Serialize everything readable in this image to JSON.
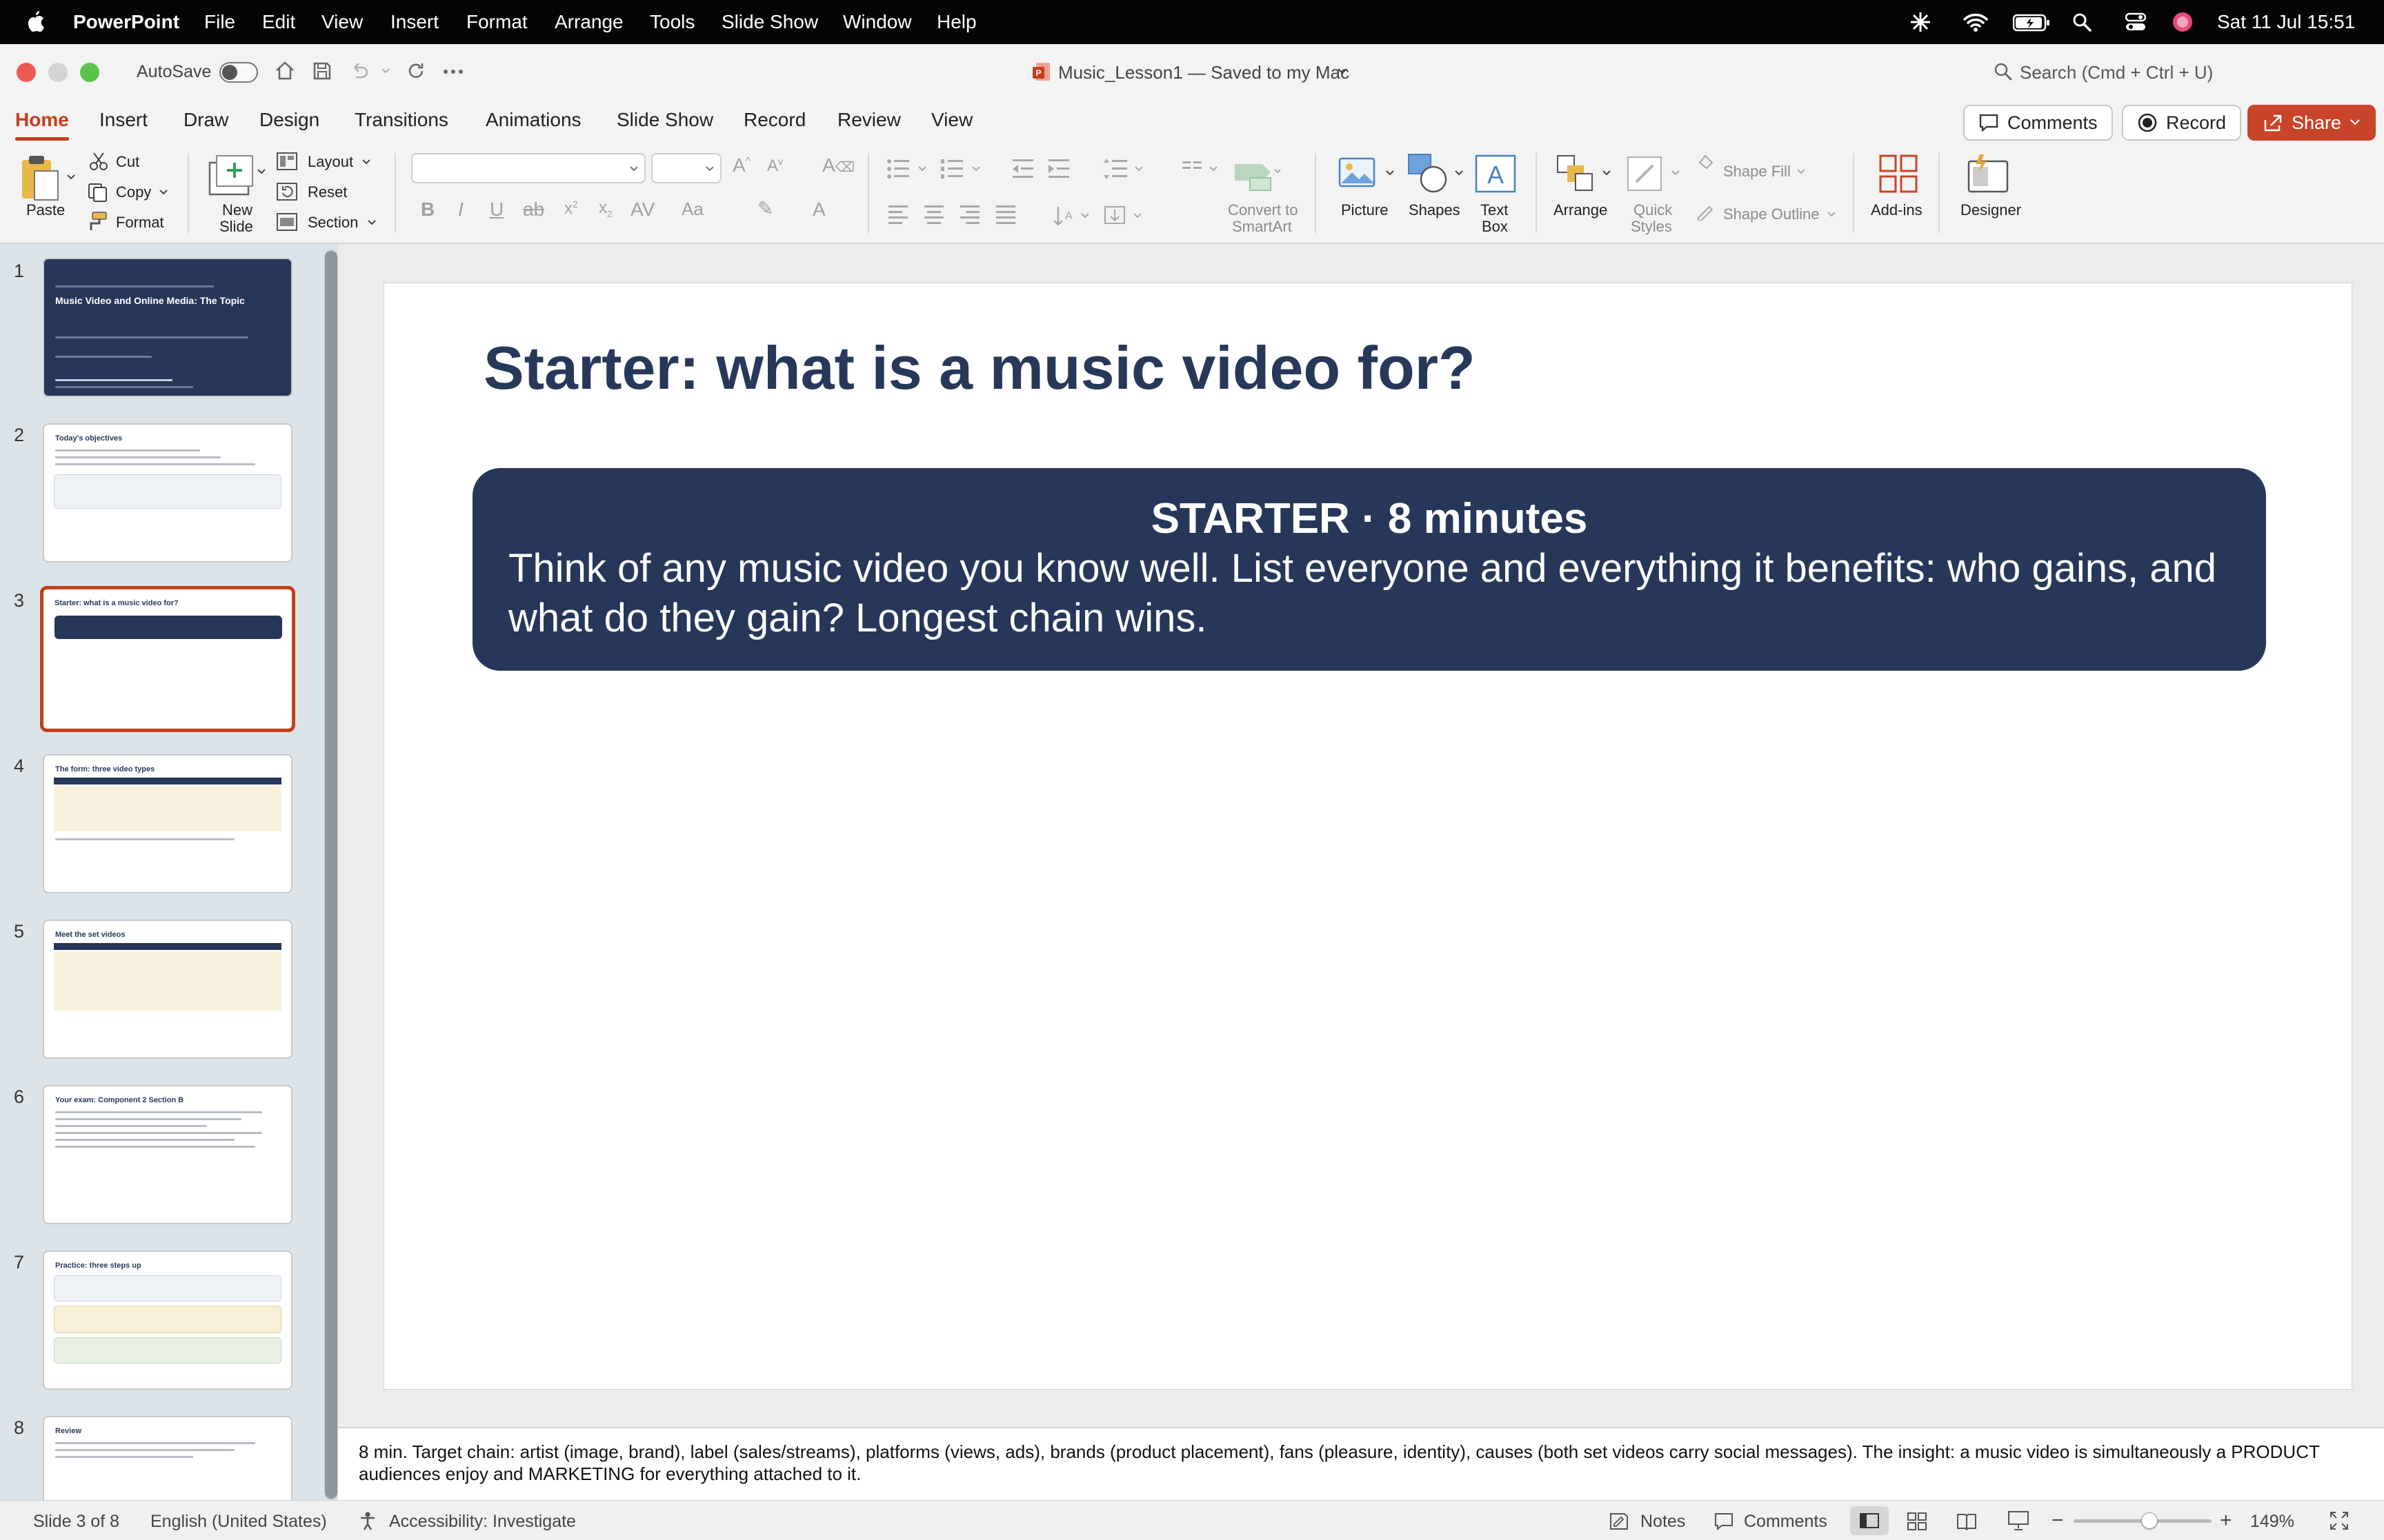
{
  "menubar": {
    "app_name": "PowerPoint",
    "items": [
      "File",
      "Edit",
      "View",
      "Insert",
      "Format",
      "Arrange",
      "Tools",
      "Slide Show",
      "Window",
      "Help"
    ],
    "datetime": "Sat 11 Jul  15:51"
  },
  "titlebar": {
    "autosave_label": "AutoSave",
    "doc_title": "Music_Lesson1 — Saved to my Mac",
    "search_placeholder": "Search (Cmd + Ctrl + U)"
  },
  "ribbon_tabs": {
    "tabs": [
      "Home",
      "Insert",
      "Draw",
      "Design",
      "Transitions",
      "Animations",
      "Slide Show",
      "Record",
      "Review",
      "View"
    ],
    "active": "Home",
    "comments_label": "Comments",
    "record_label": "Record",
    "share_label": "Share"
  },
  "ribbon": {
    "paste": "Paste",
    "cut": "Cut",
    "copy": "Copy",
    "format": "Format",
    "new_slide_1": "New",
    "new_slide_2": "Slide",
    "layout": "Layout",
    "reset": "Reset",
    "section": "Section",
    "convert_1": "Convert to",
    "convert_2": "SmartArt",
    "picture": "Picture",
    "shapes": "Shapes",
    "textbox_1": "Text",
    "textbox_2": "Box",
    "arrange": "Arrange",
    "quick_styles_1": "Quick",
    "quick_styles_2": "Styles",
    "shape_fill": "Shape Fill",
    "shape_outline": "Shape Outline",
    "addins": "Add-ins",
    "designer": "Designer"
  },
  "thumbnails": [
    {
      "num": "1",
      "title": "Music Video and Online Media: The Topic"
    },
    {
      "num": "2",
      "title": "Today's objectives"
    },
    {
      "num": "3",
      "title": "Starter: what is a music video for?"
    },
    {
      "num": "4",
      "title": "The form: three video types"
    },
    {
      "num": "5",
      "title": "Meet the set videos"
    },
    {
      "num": "6",
      "title": "Your exam: Component 2 Section B"
    },
    {
      "num": "7",
      "title": "Practice: three steps up"
    },
    {
      "num": "8",
      "title": "Review"
    }
  ],
  "slide": {
    "title": "Starter: what is a music video for?",
    "box_heading": "STARTER · 8 minutes",
    "box_body": "Think of any music video you know well. List everyone and everything it benefits: who gains, and what do they gain? Longest chain wins."
  },
  "notes": "8 min. Target chain: artist (image, brand), label (sales/streams), platforms (views, ads), brands (product placement), fans (pleasure, identity), causes (both set videos carry social messages). The insight: a music video is simultaneously a PRODUCT audiences enjoy and MARKETING for everything attached to it.",
  "status": {
    "slide_pos": "Slide 3 of 8",
    "language": "English (United States)",
    "accessibility": "Accessibility: Investigate",
    "notes_btn": "Notes",
    "comments_btn": "Comments",
    "zoom": "149%",
    "zoom_fraction": 0.55
  },
  "colors": {
    "accent": "#c43e1c",
    "slide_navy": "#27375a",
    "share_bg": "#c9452a"
  }
}
